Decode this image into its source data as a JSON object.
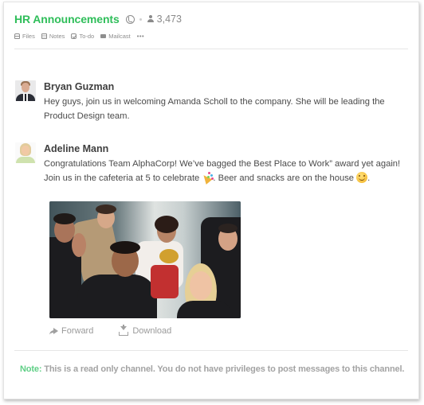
{
  "channel": {
    "title": "HR Announcements",
    "visibility_icon": "globe-icon",
    "member_icon": "person-icon",
    "member_count": "3,473",
    "accent_color": "#2fbe5a"
  },
  "tools": [
    {
      "label": "Files",
      "icon": "files-icon"
    },
    {
      "label": "Notes",
      "icon": "notes-icon"
    },
    {
      "label": "To-do",
      "icon": "todo-icon"
    },
    {
      "label": "Mailcast",
      "icon": "mail-icon"
    }
  ],
  "more_label": "•••",
  "messages": [
    {
      "author": "Bryan Guzman",
      "text": "Hey guys, join us in welcoming Amanda Scholl to the company. She will be leading the Product Design team."
    },
    {
      "author": "Adeline Mann",
      "text_part1": "Congratulations Team AlphaCorp! We’ve bagged the Best Place to Work” award yet again! Join us in the cafeteria at 5 to celebrate ",
      "emoji1": "party-popper-emoji",
      "text_part2": ". Beer and snacks are on the house ",
      "emoji2": "smiling-face-emoji",
      "text_part3": ".",
      "attachment": {
        "type": "image",
        "description": "Group of cheering office workers holding a trophy"
      },
      "actions": [
        {
          "label": "Forward",
          "icon": "forward-icon"
        },
        {
          "label": "Download",
          "icon": "download-icon"
        }
      ]
    }
  ],
  "footer": {
    "note_label": "Note:",
    "note_text": " This is a read only channel. You do not have privileges to post messages to this channel.",
    "note_color": "#5fcf86"
  }
}
